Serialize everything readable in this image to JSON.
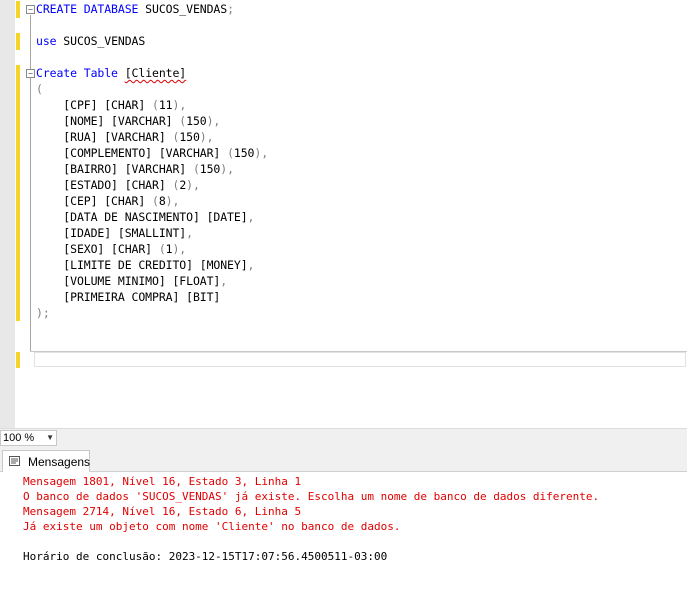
{
  "editor": {
    "lines": [
      [
        {
          "t": "CREATE DATABASE",
          "c": "kw"
        },
        {
          "t": " SUCOS_VENDAS",
          "c": "bk"
        },
        {
          "t": ";",
          "c": "gr"
        }
      ],
      [],
      [
        {
          "t": "use",
          "c": "kw"
        },
        {
          "t": " SUCOS_VENDAS",
          "c": "bk"
        }
      ],
      [],
      [
        {
          "t": "Create Table",
          "c": "kw"
        },
        {
          "t": " ",
          "c": "bk"
        },
        {
          "t": "[Cliente]",
          "c": "bk",
          "sq": true
        }
      ],
      [
        {
          "t": "(",
          "c": "gr"
        }
      ],
      [
        {
          "t": "    [CPF] [CHAR] ",
          "c": "bk"
        },
        {
          "t": "(",
          "c": "gr"
        },
        {
          "t": "11",
          "c": "bk"
        },
        {
          "t": "),",
          "c": "gr"
        }
      ],
      [
        {
          "t": "    [NOME] [VARCHAR] ",
          "c": "bk"
        },
        {
          "t": "(",
          "c": "gr"
        },
        {
          "t": "150",
          "c": "bk"
        },
        {
          "t": "),",
          "c": "gr"
        }
      ],
      [
        {
          "t": "    [RUA] [VARCHAR] ",
          "c": "bk"
        },
        {
          "t": "(",
          "c": "gr"
        },
        {
          "t": "150",
          "c": "bk"
        },
        {
          "t": "),",
          "c": "gr"
        }
      ],
      [
        {
          "t": "    [COMPLEMENTO] [VARCHAR] ",
          "c": "bk"
        },
        {
          "t": "(",
          "c": "gr"
        },
        {
          "t": "150",
          "c": "bk"
        },
        {
          "t": "),",
          "c": "gr"
        }
      ],
      [
        {
          "t": "    [BAIRRO] [VARCHAR] ",
          "c": "bk"
        },
        {
          "t": "(",
          "c": "gr"
        },
        {
          "t": "150",
          "c": "bk"
        },
        {
          "t": "),",
          "c": "gr"
        }
      ],
      [
        {
          "t": "    [ESTADO] [CHAR] ",
          "c": "bk"
        },
        {
          "t": "(",
          "c": "gr"
        },
        {
          "t": "2",
          "c": "bk"
        },
        {
          "t": "),",
          "c": "gr"
        }
      ],
      [
        {
          "t": "    [CEP] [CHAR] ",
          "c": "bk"
        },
        {
          "t": "(",
          "c": "gr"
        },
        {
          "t": "8",
          "c": "bk"
        },
        {
          "t": "),",
          "c": "gr"
        }
      ],
      [
        {
          "t": "    [DATA DE NASCIMENTO] [DATE]",
          "c": "bk"
        },
        {
          "t": ",",
          "c": "gr"
        }
      ],
      [
        {
          "t": "    [IDADE] [SMALLINT]",
          "c": "bk"
        },
        {
          "t": ",",
          "c": "gr"
        }
      ],
      [
        {
          "t": "    [SEXO] [CHAR] ",
          "c": "bk"
        },
        {
          "t": "(",
          "c": "gr"
        },
        {
          "t": "1",
          "c": "bk"
        },
        {
          "t": "),",
          "c": "gr"
        }
      ],
      [
        {
          "t": "    [LIMITE DE CREDITO] [MONEY]",
          "c": "bk"
        },
        {
          "t": ",",
          "c": "gr"
        }
      ],
      [
        {
          "t": "    [VOLUME MINIMO] [FLOAT]",
          "c": "bk"
        },
        {
          "t": ",",
          "c": "gr"
        }
      ],
      [
        {
          "t": "    [PRIMEIRA COMPRA] [BIT]",
          "c": "bk"
        }
      ],
      [
        {
          "t": ");",
          "c": "gr"
        }
      ]
    ]
  },
  "zoom": {
    "value": "100 %"
  },
  "results": {
    "tab_label": "Mensagens",
    "messages": [
      {
        "text": "Mensagem 1801, Nível 16, Estado 3, Linha 1",
        "kind": "err"
      },
      {
        "text": "O banco de dados 'SUCOS_VENDAS' já existe. Escolha um nome de banco de dados diferente.",
        "kind": "err"
      },
      {
        "text": "Mensagem 2714, Nível 16, Estado 6, Linha 5",
        "kind": "err"
      },
      {
        "text": "Já existe um objeto com nome 'Cliente' no banco de dados.",
        "kind": "err"
      },
      {
        "text": "",
        "kind": "info"
      },
      {
        "text": "Horário de conclusão: 2023-12-15T17:07:56.4500511-03:00",
        "kind": "info"
      }
    ]
  },
  "colors": {
    "keyword": "#0000ff",
    "punctuation": "#808080",
    "error": "#e00000",
    "change_marker": "#f5d327"
  }
}
